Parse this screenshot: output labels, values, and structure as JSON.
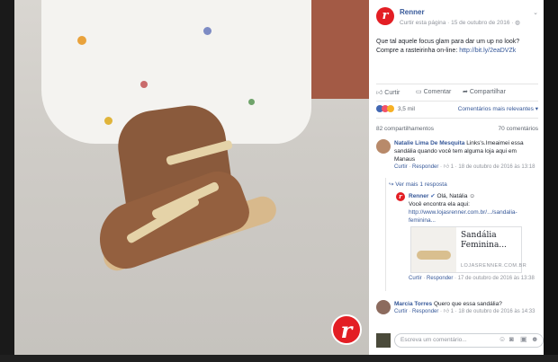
{
  "post": {
    "page_name": "Renner",
    "meta": "Curtir esta página · 15 de outubro de 2016 · ",
    "text": "Que tal aquele focus glam para dar um up no look? Compre a rasteirinha on-line: ",
    "link": "http://bit.ly/2eaDVZk",
    "logo_letter": "r"
  },
  "actions": {
    "like": "Curtir",
    "comment": "Comentar",
    "share": "Compartilhar"
  },
  "reactions": {
    "count": "3,5 mil",
    "filter": "Comentários mais relevantes"
  },
  "counts": {
    "shares": "82 compartilhamentos",
    "comments": "70 comentários"
  },
  "comments": [
    {
      "name": "Natalie Lima De Mesquita",
      "text": " Links's.Imeaimei essa sandália quando você tem alguma loja aqui em Manaus",
      "like": "Curtir",
      "reply": "Responder",
      "likes": "1",
      "date": "18 de outubro de 2016 às 13:18"
    },
    {
      "name": "Marcia Torres",
      "text": " Quero que essa sandália?",
      "like": "Curtir",
      "reply": "Responder",
      "likes": "1",
      "date": "18 de outubro de 2016 às 14:33"
    }
  ],
  "more_replies": "Ver mais 1 resposta",
  "reply": {
    "name": "Renner",
    "greeting": " Olá, Natália",
    "text": "Você encontra ela aqui:",
    "link": "http://www.lojasrenner.com.br/.../sandalia-feminina...",
    "like": "Curtir",
    "reply": "Responder",
    "date": "17 de outubro de 2016 às 13:38"
  },
  "card": {
    "title": "Sandália Feminina...",
    "domain": "LOJASRENNER.COM.BR"
  },
  "composer": {
    "placeholder": "Escreva um comentário..."
  },
  "colors": {
    "brand_red": "#e31e24",
    "link": "#365899",
    "meta": "#90949c"
  }
}
